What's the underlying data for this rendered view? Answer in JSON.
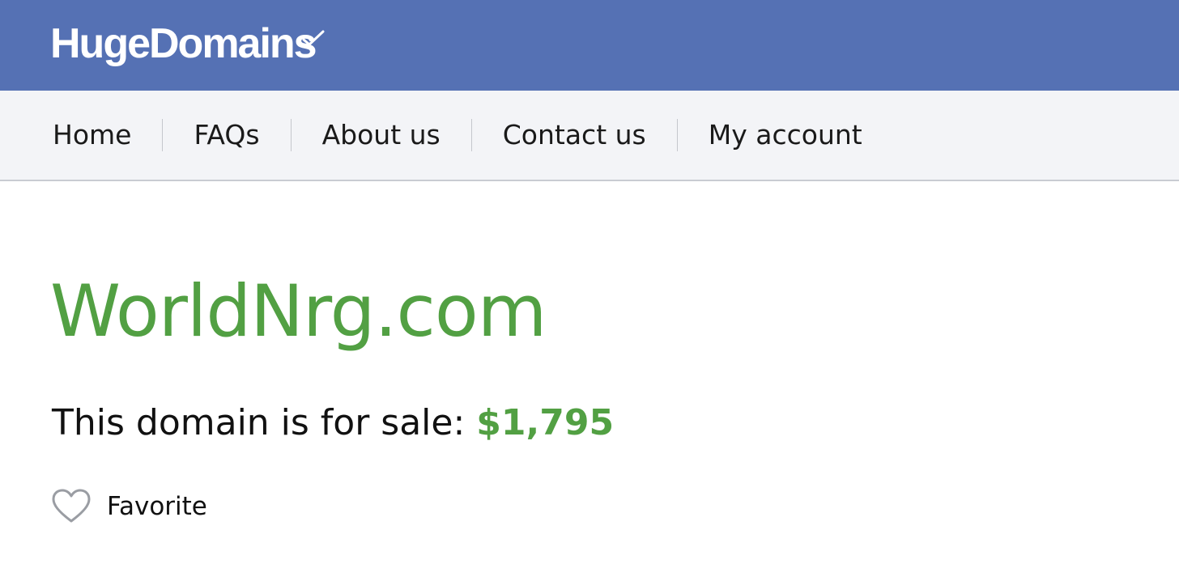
{
  "header": {
    "logo_text": "HugeDomains",
    "background_color": "#5571b4"
  },
  "nav": {
    "items": [
      {
        "label": "Home"
      },
      {
        "label": "FAQs"
      },
      {
        "label": "About us"
      },
      {
        "label": "Contact us"
      },
      {
        "label": "My account"
      }
    ]
  },
  "main": {
    "domain_name": "WorldNrg.com",
    "sale_text": "This domain is for sale:",
    "price": "$1,795",
    "favorite_label": "Favorite",
    "favorite_icon": "heart-icon",
    "accent_color": "#52a043"
  }
}
